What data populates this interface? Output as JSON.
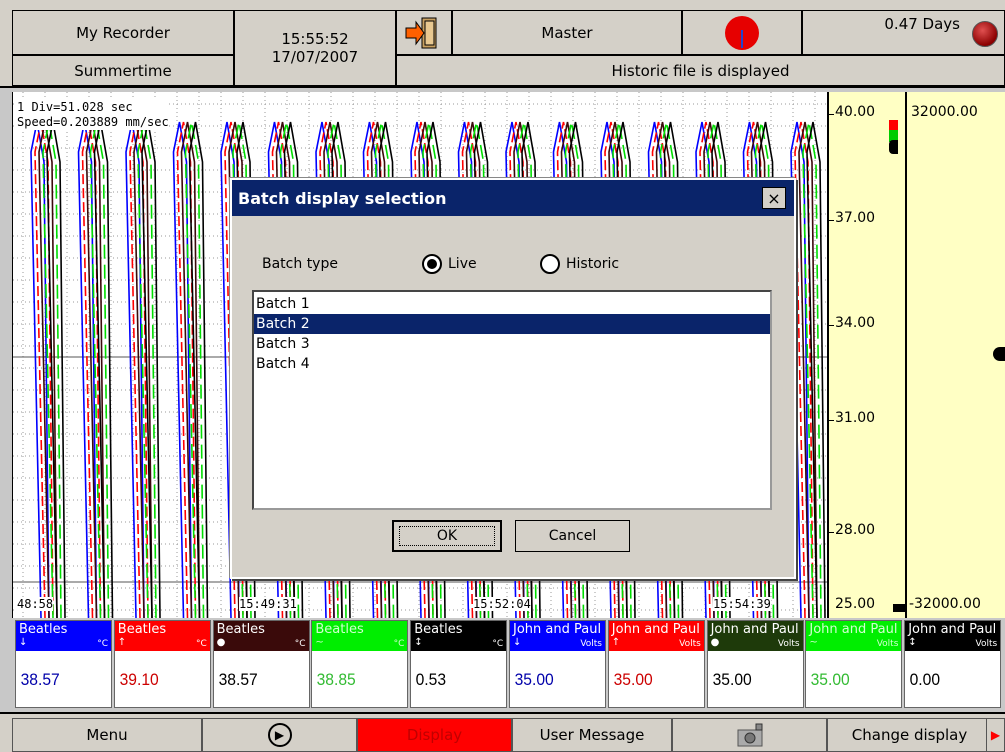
{
  "header": {
    "recorder_name": "My Recorder",
    "summertime": "Summertime",
    "time": "15:55:52",
    "date": "17/07/2007",
    "user": "Master",
    "days": "0.47 Days",
    "status": "Historic file is displayed"
  },
  "chart": {
    "div_info": "1 Div=51.028 sec",
    "speed_info": "Speed=0.203889 mm/sec",
    "x_ticks": [
      "48:58",
      "15:49:31",
      "15:52:04",
      "15:54:39"
    ],
    "series_colors": [
      "#0000ff",
      "#ff0000",
      "#3a0a0a",
      "#00dd00",
      "#000000"
    ]
  },
  "scale1": {
    "ticks": [
      "40.00",
      "37.00",
      "34.00",
      "31.00",
      "28.00",
      "25.00"
    ]
  },
  "scale2": {
    "max": "32000.00",
    "min": "-32000.00"
  },
  "channels": [
    {
      "name": "Beatles",
      "unit": "°C",
      "value": "38.57",
      "color": "#0000ff",
      "text": "#ffffff",
      "valcolor": "#0000aa",
      "arrow": "↓"
    },
    {
      "name": "Beatles",
      "unit": "°C",
      "value": "39.10",
      "color": "#ff0000",
      "text": "#ffffff",
      "valcolor": "#cc0000",
      "arrow": "↑"
    },
    {
      "name": "Beatles",
      "unit": "°C",
      "value": "38.57",
      "color": "#3a0a0a",
      "text": "#ffffff",
      "valcolor": "#000000",
      "arrow": "●"
    },
    {
      "name": "Beatles",
      "unit": "°C",
      "value": "38.85",
      "color": "#00ee00",
      "text": "#d0ffd0",
      "valcolor": "#33bb33",
      "arrow": "~"
    },
    {
      "name": "Beatles",
      "unit": "°C",
      "value": "0.53",
      "color": "#000000",
      "text": "#ffffff",
      "valcolor": "#000000",
      "arrow": "↕"
    },
    {
      "name": "John and Paul",
      "unit": "Volts",
      "value": "35.00",
      "color": "#0000ff",
      "text": "#ffffff",
      "valcolor": "#0000aa",
      "arrow": "↓"
    },
    {
      "name": "John and Paul",
      "unit": "Volts",
      "value": "35.00",
      "color": "#ff0000",
      "text": "#ffffff",
      "valcolor": "#cc0000",
      "arrow": "↑"
    },
    {
      "name": "John and Paul",
      "unit": "Volts",
      "value": "35.00",
      "color": "#1e3a0a",
      "text": "#ffffff",
      "valcolor": "#000000",
      "arrow": "●"
    },
    {
      "name": "John and Paul",
      "unit": "Volts",
      "value": "35.00",
      "color": "#00ee00",
      "text": "#d0ffd0",
      "valcolor": "#33bb33",
      "arrow": "~"
    },
    {
      "name": "John and Paul",
      "unit": "Volts",
      "value": "0.00",
      "color": "#000000",
      "text": "#ffffff",
      "valcolor": "#000000",
      "arrow": "↕"
    }
  ],
  "bottom": {
    "menu": "Menu",
    "display": "Display",
    "user_message": "User Message",
    "change_display": "Change display",
    "display_color": "#ff0000"
  },
  "dialog": {
    "title": "Batch display selection",
    "close": "×",
    "batch_type_label": "Batch type",
    "radio_live": "Live",
    "radio_historic": "Historic",
    "selected_type": "Live",
    "items": [
      "Batch 1",
      "Batch 2",
      "Batch 3",
      "Batch 4"
    ],
    "selected_item": "Batch 2",
    "ok": "OK",
    "cancel": "Cancel"
  }
}
